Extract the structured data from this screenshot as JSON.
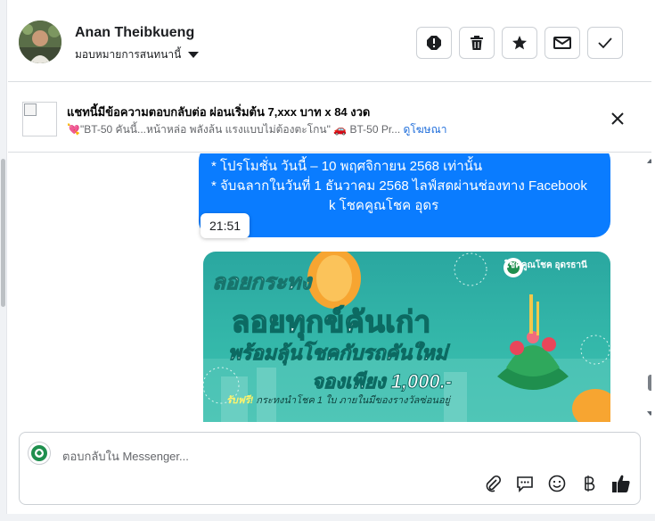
{
  "header": {
    "name": "Anan Theibkueng",
    "assign_label": "มอบหมายการสนทนานี้",
    "actions": [
      "mark-spam",
      "delete",
      "star",
      "mark-unread",
      "mark-done"
    ]
  },
  "ad": {
    "title": "แชทนี้มีข้อความตอบกลับต่อ ผ่อนเริ่มต้น 7,xxx บาท x 84 งวด",
    "snippet": "💘\"BT-50 คันนี้...หน้าหล่อ พลังล้น แรงแบบไม่ต้องตะโกน\" 🚗 BT-50 Pr...",
    "link_label": "ดูโฆษณา"
  },
  "conversation": {
    "message_lines": [
      "* โปรโมชั่น วันนี้ – 10 พฤศจิกายน 2568 เท่านั้น",
      "* จับฉลากในวันที่ 1 ธันวาคม 2568 ไลฟ์สดผ่านช่องทาง Facebook",
      "k โชคคูณโชค อุดร"
    ],
    "timestamp": "21:51",
    "banner": {
      "title": "ลอยกระทง",
      "headline": "ลอยทุกข์คันเก่า",
      "subline": "พร้อมลุ้นโชคกับรถคันใหม่",
      "price": "จองเพียง 1,000.-",
      "free_prefix": "รับฟรี!",
      "free_text": " กระทงนำโชค 1 ใบ ภายในมีของรางวัลซ่อนอยู่",
      "brand": "โชคคูณโชค อุดรธานี"
    }
  },
  "composer": {
    "placeholder": "ตอบกลับใน Messenger...",
    "tools": [
      "attach-icon",
      "saved-reply-icon",
      "emoji-icon",
      "baht-icon",
      "like-icon"
    ]
  },
  "colors": {
    "bubble": "#0a7cff",
    "accent": "#216fdb",
    "banner_teal": "#34b8aa"
  }
}
